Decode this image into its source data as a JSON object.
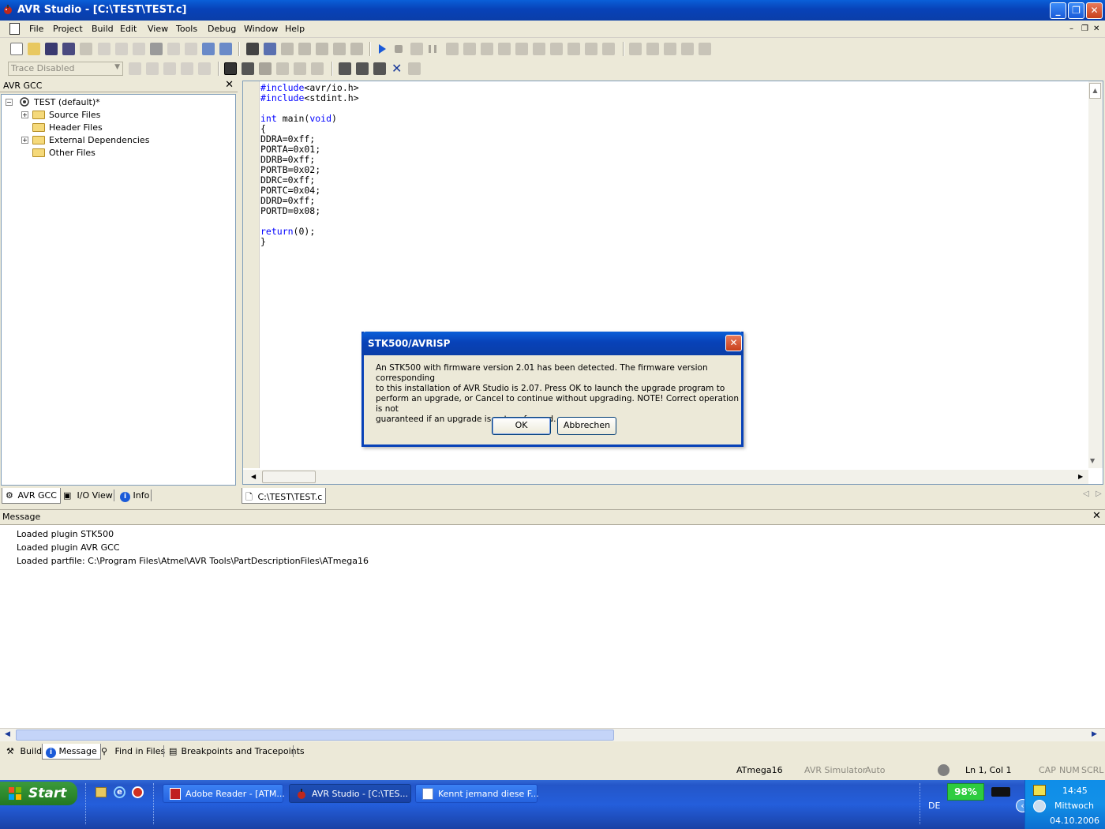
{
  "window": {
    "title": "AVR Studio - [C:\\TEST\\TEST.c]"
  },
  "menu": [
    "File",
    "Project",
    "Build",
    "Edit",
    "View",
    "Tools",
    "Debug",
    "Window",
    "Help"
  ],
  "toolbar": {
    "trace_select": "Trace Disabled"
  },
  "project_panel": {
    "title": "AVR GCC",
    "tree": {
      "root": "TEST (default)*",
      "items": [
        "Source Files",
        "Header Files",
        "External Dependencies",
        "Other Files"
      ]
    },
    "tabs": [
      "AVR GCC",
      "I/O View",
      "Info"
    ]
  },
  "editor": {
    "tab": "C:\\TEST\\TEST.c",
    "lines": [
      "#include<avr/io.h>",
      "#include<stdint.h>",
      "",
      "int main(void)",
      "{",
      "DDRA=0xff;",
      "PORTA=0x01;",
      "DDRB=0xff;",
      "PORTB=0x02;",
      "DDRC=0xff;",
      "PORTC=0x04;",
      "DDRD=0xff;",
      "PORTD=0x08;",
      "",
      "return(0);",
      "}"
    ]
  },
  "dialog": {
    "title": "STK500/AVRISP",
    "lines": [
      "An STK500 with firmware version 2.01 has been detected. The firmware version corresponding",
      "to this installation of AVR Studio is 2.07. Press OK to launch the upgrade program to",
      "perform an upgrade, or Cancel to continue without upgrading. NOTE! Correct operation is not",
      "guaranteed if an upgrade is not performed."
    ],
    "ok_label": "OK",
    "cancel_label": "Abbrechen"
  },
  "message_panel": {
    "title": "Message",
    "lines": [
      "Loaded plugin STK500",
      "Loaded plugin AVR GCC",
      "Loaded partfile: C:\\Program Files\\Atmel\\AVR Tools\\PartDescriptionFiles\\ATmega16"
    ],
    "tabs": [
      "Build",
      "Message",
      "Find in Files",
      "Breakpoints and Tracepoints"
    ]
  },
  "statusbar": {
    "device": "ATmega16",
    "platform": "AVR Simulator",
    "mode": "Auto",
    "position": "Ln 1, Col 1",
    "cap": "CAP",
    "num": "NUM",
    "scrl": "SCRL"
  },
  "taskbar": {
    "start_label": "Start",
    "tasks": [
      "Adobe Reader - [ATM...",
      "AVR Studio - [C:\\TES...",
      "Kennt jemand diese F..."
    ],
    "language": "DE",
    "battery": "98%",
    "time": "14:45",
    "weekday": "Mittwoch",
    "date": "04.10.2006"
  }
}
